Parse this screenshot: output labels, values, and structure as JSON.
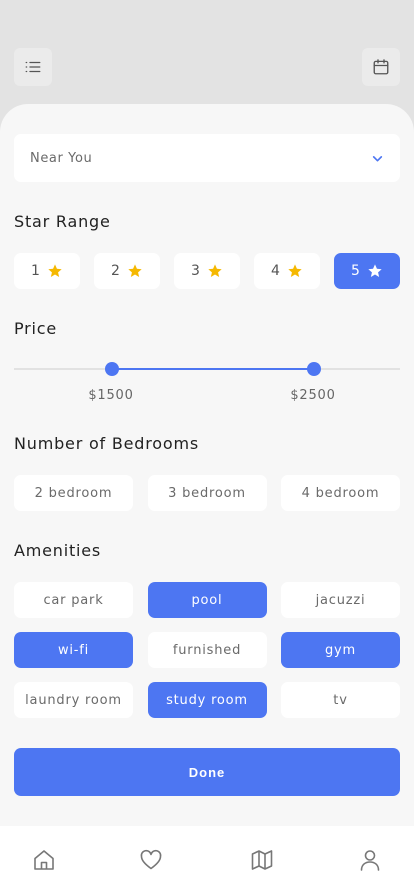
{
  "top_bar": {
    "menu_icon": "list-icon",
    "calendar_icon": "calendar-icon"
  },
  "location": {
    "selected": "Near You",
    "icon": "chevron-down-icon"
  },
  "star_range": {
    "heading": "Star Range",
    "options": [
      {
        "label": "1",
        "active": false
      },
      {
        "label": "2",
        "active": false
      },
      {
        "label": "3",
        "active": false
      },
      {
        "label": "4",
        "active": false
      },
      {
        "label": "5",
        "active": true
      }
    ],
    "star_color": "#f5b800"
  },
  "price": {
    "heading": "Price",
    "min_label": "$1500",
    "max_label": "$2500"
  },
  "bedrooms": {
    "heading": "Number of Bedrooms",
    "options": [
      {
        "label": "2 bedroom",
        "active": false
      },
      {
        "label": "3 bedroom",
        "active": false
      },
      {
        "label": "4 bedroom",
        "active": false
      }
    ]
  },
  "amenities": {
    "heading": "Amenities",
    "options": [
      {
        "label": "car park",
        "active": false
      },
      {
        "label": "pool",
        "active": true
      },
      {
        "label": "jacuzzi",
        "active": false
      },
      {
        "label": "wi-fi",
        "active": true
      },
      {
        "label": "furnished",
        "active": false
      },
      {
        "label": "gym",
        "active": true
      },
      {
        "label": "laundry room",
        "active": false
      },
      {
        "label": "study room",
        "active": true
      },
      {
        "label": "tv",
        "active": false
      }
    ]
  },
  "done_label": "Done",
  "nav": {
    "items": [
      "home-icon",
      "heart-icon",
      "map-icon",
      "profile-icon"
    ]
  },
  "colors": {
    "accent": "#4d76f2",
    "background": "#e3e3e3",
    "sheet": "#f7f7f7"
  }
}
